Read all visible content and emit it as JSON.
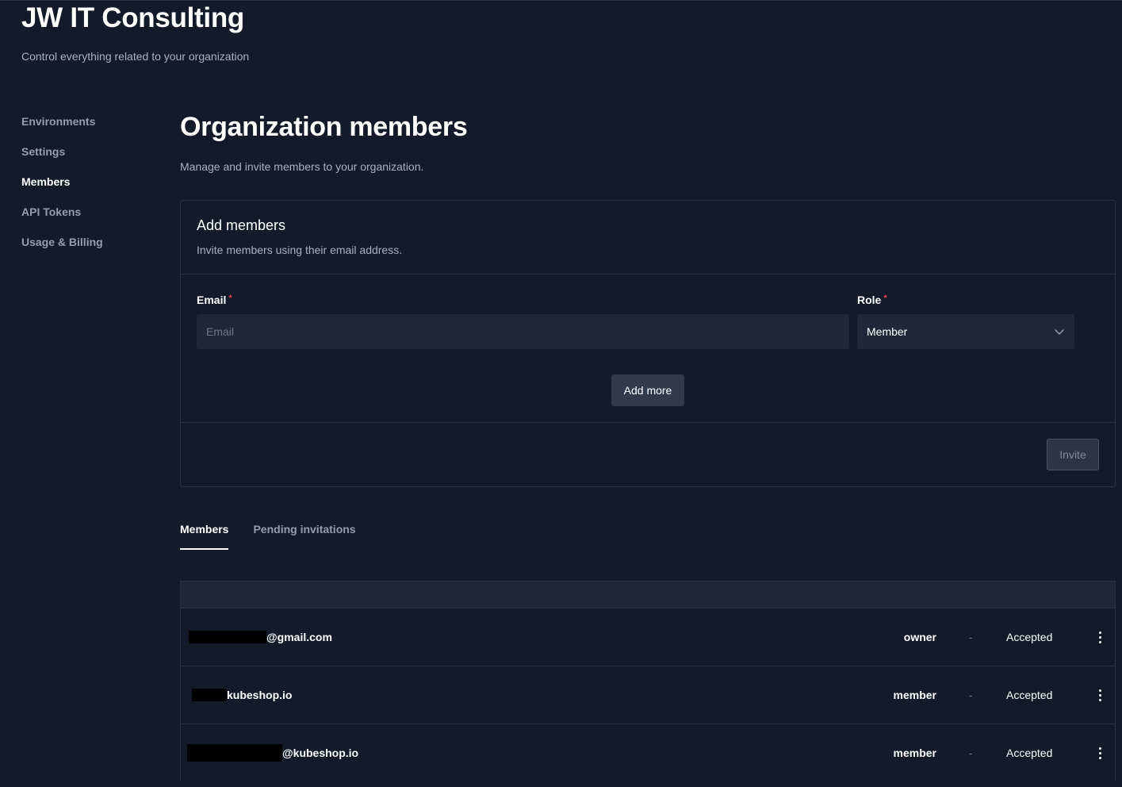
{
  "header": {
    "org_name": "JW IT Consulting",
    "subtitle": "Control everything related to your organization"
  },
  "sidebar": {
    "items": [
      {
        "label": "Environments",
        "active": false
      },
      {
        "label": "Settings",
        "active": false
      },
      {
        "label": "Members",
        "active": true
      },
      {
        "label": "API Tokens",
        "active": false
      },
      {
        "label": "Usage & Billing",
        "active": false
      }
    ]
  },
  "main": {
    "title": "Organization members",
    "description": "Manage and invite members to your organization."
  },
  "add_members": {
    "title": "Add members",
    "description": "Invite members using their email address.",
    "email_label": "Email",
    "email_placeholder": "Email",
    "email_value": "",
    "role_label": "Role",
    "role_value": "Member",
    "required_marker": "*",
    "add_more_label": "Add more",
    "invite_label": "Invite"
  },
  "tabs": [
    {
      "label": "Members",
      "active": true
    },
    {
      "label": "Pending invitations",
      "active": false
    }
  ],
  "members": [
    {
      "email_visible": "@gmail.com",
      "role": "owner",
      "dash": "-",
      "status": "Accepted"
    },
    {
      "email_visible": "kubeshop.io",
      "role": "member",
      "dash": "-",
      "status": "Accepted"
    },
    {
      "email_visible": "@kubeshop.io",
      "role": "member",
      "dash": "-",
      "status": "Accepted"
    }
  ],
  "icons": {
    "role_dropdown": "chevron-down-icon",
    "row_menu": "more-vertical-icon"
  },
  "colors": {
    "background": "#131a2a",
    "surface": "#1f2738",
    "border": "#283042",
    "required": "#e0454f",
    "muted_text": "#a9b1c0"
  }
}
